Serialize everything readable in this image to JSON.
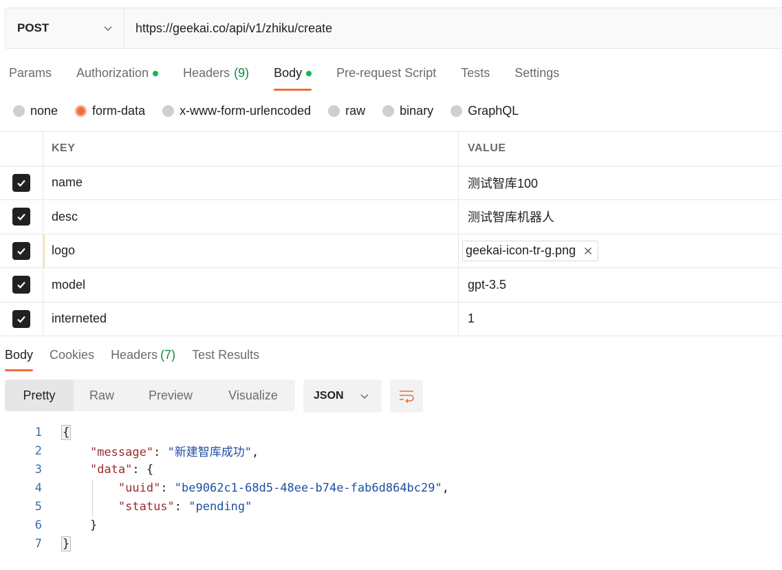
{
  "request": {
    "method": "POST",
    "url": "https://geekai.co/api/v1/zhiku/create"
  },
  "request_tabs": [
    {
      "label": "Params",
      "dot": false,
      "count": ""
    },
    {
      "label": "Authorization",
      "dot": true,
      "count": ""
    },
    {
      "label": "Headers",
      "dot": false,
      "count": "(9)"
    },
    {
      "label": "Body",
      "dot": true,
      "count": "",
      "active": true
    },
    {
      "label": "Pre-request Script",
      "dot": false,
      "count": ""
    },
    {
      "label": "Tests",
      "dot": false,
      "count": ""
    },
    {
      "label": "Settings",
      "dot": false,
      "count": ""
    }
  ],
  "body_types": [
    {
      "label": "none",
      "selected": false
    },
    {
      "label": "form-data",
      "selected": true
    },
    {
      "label": "x-www-form-urlencoded",
      "selected": false
    },
    {
      "label": "raw",
      "selected": false
    },
    {
      "label": "binary",
      "selected": false
    },
    {
      "label": "GraphQL",
      "selected": false
    }
  ],
  "params_table": {
    "headers": {
      "key": "KEY",
      "value": "VALUE"
    },
    "rows": [
      {
        "key": "name",
        "value": "测试智库100",
        "type": "text"
      },
      {
        "key": "desc",
        "value": "测试智库机器人",
        "type": "text"
      },
      {
        "key": "logo",
        "value": "geekai-icon-tr-g.png",
        "type": "file"
      },
      {
        "key": "model",
        "value": "gpt-3.5",
        "type": "text"
      },
      {
        "key": "interneted",
        "value": "1",
        "type": "text"
      }
    ]
  },
  "response_tabs": [
    {
      "label": "Body",
      "count": "",
      "active": true
    },
    {
      "label": "Cookies",
      "count": ""
    },
    {
      "label": "Headers",
      "count": "(7)"
    },
    {
      "label": "Test Results",
      "count": ""
    }
  ],
  "view_modes": [
    "Pretty",
    "Raw",
    "Preview",
    "Visualize"
  ],
  "active_view": "Pretty",
  "format": "JSON",
  "response_body": {
    "line_numbers": [
      "1",
      "2",
      "3",
      "4",
      "5",
      "6",
      "7"
    ],
    "message_key": "\"message\"",
    "message_value": "\"新建智库成功\"",
    "data_key": "\"data\"",
    "uuid_key": "\"uuid\"",
    "uuid_value": "\"be9062c1-68d5-48ee-b74e-fab6d864bc29\"",
    "status_key": "\"status\"",
    "status_value": "\"pending\""
  },
  "colors": {
    "accent": "#f26b3a",
    "dot_green": "#0cbb52",
    "json_key": "#9b2b2b",
    "json_string": "#1f4fa0"
  }
}
